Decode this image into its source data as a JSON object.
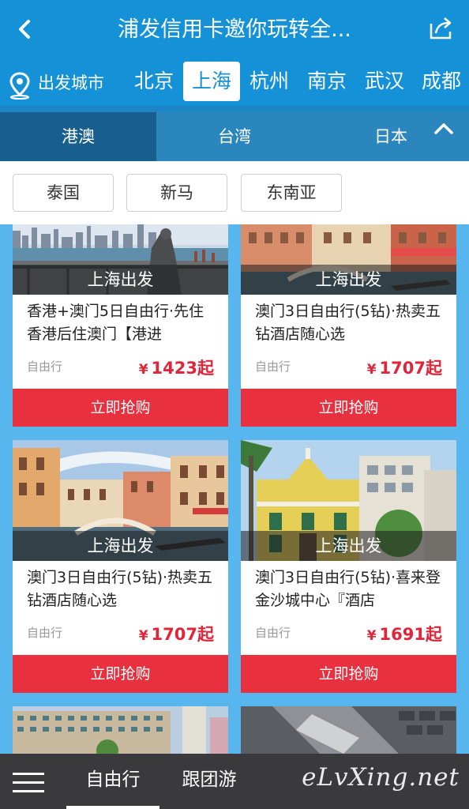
{
  "header": {
    "title": "浦发信用卡邀你玩转全..."
  },
  "citybar": {
    "label": "出发城市",
    "cities": [
      "北京",
      "上海",
      "杭州",
      "南京",
      "武汉",
      "成都"
    ],
    "active": "上海"
  },
  "regions": {
    "tabs": [
      "港澳",
      "台湾",
      "日本"
    ],
    "active": "港澳"
  },
  "subtabs": [
    "泰国",
    "新马",
    "东南亚"
  ],
  "products": [
    {
      "departure": "上海出发",
      "title": "香港+澳门5日自由行·先住香港后住澳门【港进",
      "type": "自由行",
      "currency": "¥",
      "price": "1423起",
      "button": "立即抢购"
    },
    {
      "departure": "上海出发",
      "title": "澳门3日自由行(5钻)·热卖五钻酒店随心选",
      "type": "自由行",
      "currency": "¥",
      "price": "1707起",
      "button": "立即抢购"
    },
    {
      "departure": "上海出发",
      "title": "澳门3日自由行(5钻)·热卖五钻酒店随心选",
      "type": "自由行",
      "currency": "¥",
      "price": "1707起",
      "button": "立即抢购"
    },
    {
      "departure": "上海出发",
      "title": "澳门3日自由行(5钻)·喜来登金沙城中心『酒店",
      "type": "自由行",
      "currency": "¥",
      "price": "1691起",
      "button": "立即抢购"
    }
  ],
  "bottombar": {
    "tabs": [
      "自由行",
      "跟团游"
    ],
    "active": "自由行",
    "watermark": "eLvXing.net"
  },
  "colors": {
    "header_blue": "#1591d8",
    "page_blue": "#57b6ee",
    "price_red": "#e0253a",
    "button_red": "#e8303f",
    "region_active": "#195f8d"
  }
}
